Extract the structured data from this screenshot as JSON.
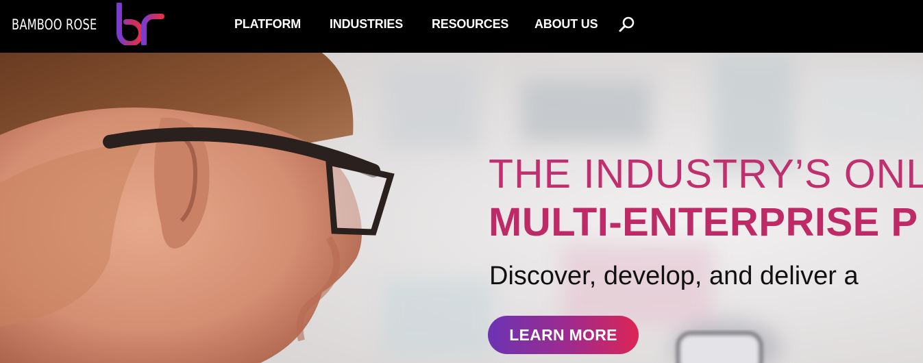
{
  "brand": {
    "name": "BAMBOO ROSE",
    "logo_icon": "br-monogram-logo",
    "logo_gradient": [
      "#7a3bd1",
      "#c0306f",
      "#e23248"
    ]
  },
  "nav": {
    "items": [
      {
        "label": "PLATFORM"
      },
      {
        "label": "INDUSTRIES"
      },
      {
        "label": "RESOURCES"
      },
      {
        "label": "ABOUT US"
      }
    ],
    "search_icon": "search-icon"
  },
  "hero": {
    "headline_line1": "THE INDUSTRY’S ONLY",
    "headline_line2": "MULTI-ENTERPRISE P",
    "tagline": "Discover, develop, and deliver a",
    "cta_label": "LEARN MORE",
    "accent_color": "#c0306f",
    "cta_gradient": [
      "#6b34b4",
      "#a02a8d",
      "#dc2555"
    ],
    "photo_subject": "woman-with-glasses-photo"
  }
}
